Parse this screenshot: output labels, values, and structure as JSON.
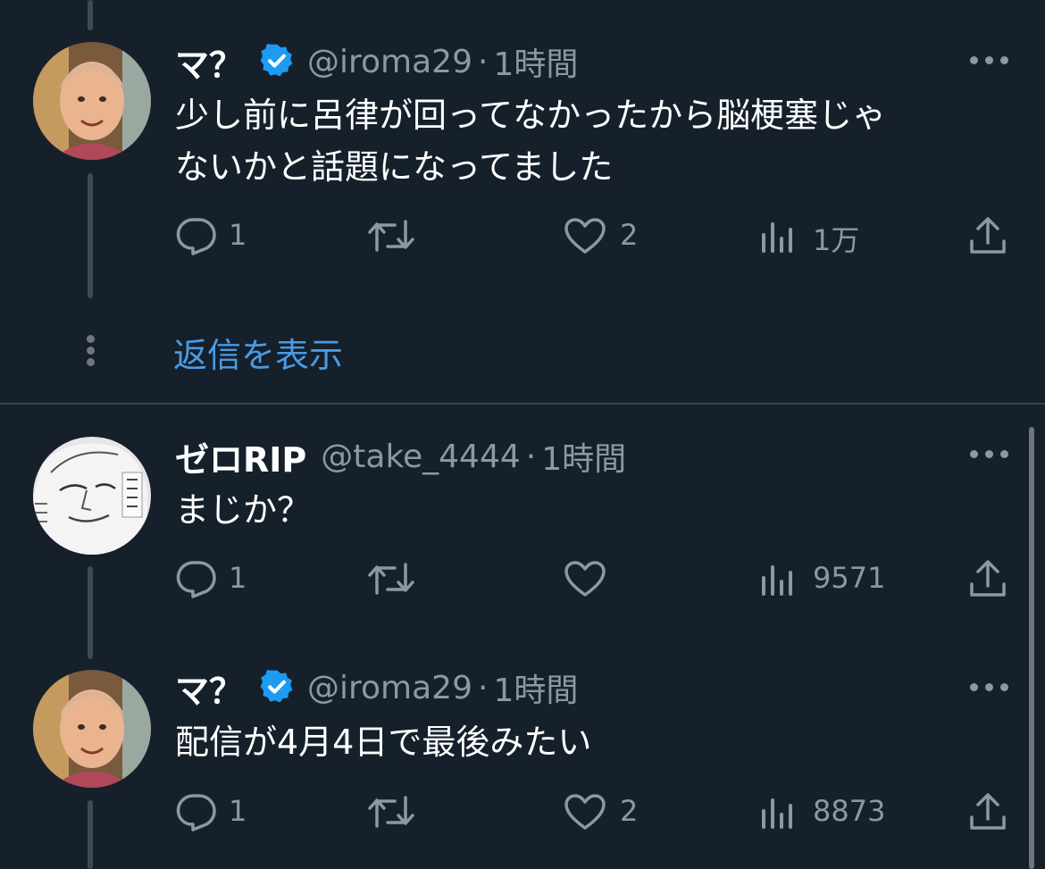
{
  "tweets": [
    {
      "name": "マ？",
      "handle": "@iroma29",
      "time": "1時間",
      "lines": [
        "少し前に呂律が回ってなかったから脳梗塞じゃ",
        "ないかと話題になってました"
      ],
      "replies": "1",
      "likes": "2",
      "views": "1万",
      "verified": true
    },
    {
      "name": "ゼロRIP",
      "handle": "@take_4444",
      "time": "1時間",
      "lines": [
        "まじか？"
      ],
      "replies": "1",
      "likes": "",
      "views": "9571",
      "verified": false
    },
    {
      "name": "マ？",
      "handle": "@iroma29",
      "time": "1時間",
      "lines": [
        "配信が4月4日で最後みたい"
      ],
      "replies": "1",
      "likes": "2",
      "views": "8873",
      "verified": true
    }
  ],
  "show_replies": "返信を表示",
  "separator": "·",
  "colors": {
    "background": "#15202b",
    "link": "#4a9be3",
    "verified": "#1d9bf0",
    "muted": "#8b98a5"
  },
  "icons": [
    "reply-icon",
    "retweet-icon",
    "like-icon",
    "views-icon",
    "share-icon",
    "more-icon",
    "verified-badge-icon"
  ]
}
